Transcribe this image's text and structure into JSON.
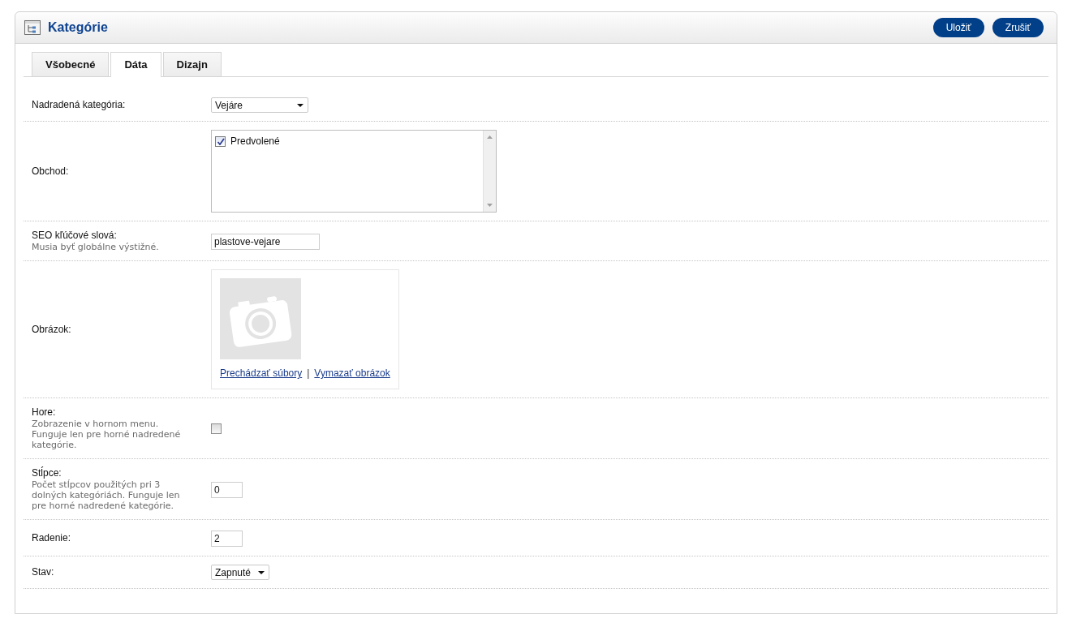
{
  "header": {
    "title": "Kategórie",
    "buttons": [
      {
        "label": "Uložiť"
      },
      {
        "label": "Zrušiť"
      }
    ]
  },
  "tabs": [
    {
      "label": "Všobecné",
      "selected": false
    },
    {
      "label": "Dáta",
      "selected": true
    },
    {
      "label": "Dizajn",
      "selected": false
    }
  ],
  "fields": [
    {
      "kind": "select",
      "label": "Nadradená kategória:",
      "value": "Vejáre"
    },
    {
      "kind": "checklist",
      "label": "Obchod:",
      "options": [
        {
          "label": "Predvolené",
          "checked": true
        }
      ]
    },
    {
      "kind": "text",
      "label": "SEO kľúčové slová:",
      "hint": "Musia byť globálne výstižné.",
      "value": "plastove-vejare"
    },
    {
      "kind": "image",
      "label": "Obrázok:",
      "links": [
        "Prechádzať súbory",
        "Vymazať obrázok"
      ],
      "separator": "|"
    },
    {
      "kind": "checkbox",
      "label": "Hore:",
      "hint": "Zobrazenie v hornom menu. Funguje len pre horné nadredené kategórie.",
      "checked": false
    },
    {
      "kind": "text",
      "label": "Stĺpce:",
      "hint": "Počet stĺpcov použitých pri 3 dolných kategóriách. Funguje len pre horné nadredené kategórie.",
      "value": "0"
    },
    {
      "kind": "text",
      "label": "Radenie:",
      "value": "2"
    },
    {
      "kind": "select",
      "label": "Stav:",
      "value": "Zapnuté"
    }
  ]
}
